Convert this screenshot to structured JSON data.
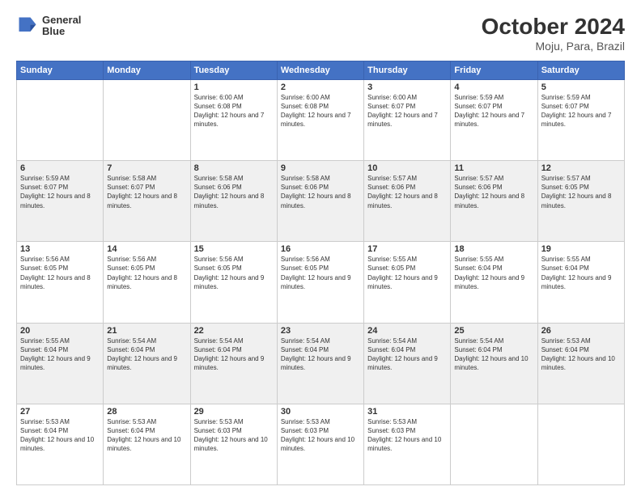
{
  "header": {
    "logo_line1": "General",
    "logo_line2": "Blue",
    "title": "October 2024",
    "subtitle": "Moju, Para, Brazil"
  },
  "days_of_week": [
    "Sunday",
    "Monday",
    "Tuesday",
    "Wednesday",
    "Thursday",
    "Friday",
    "Saturday"
  ],
  "weeks": [
    [
      {
        "day": "",
        "empty": true
      },
      {
        "day": "",
        "empty": true
      },
      {
        "day": "1",
        "sunrise": "Sunrise: 6:00 AM",
        "sunset": "Sunset: 6:08 PM",
        "daylight": "Daylight: 12 hours and 7 minutes."
      },
      {
        "day": "2",
        "sunrise": "Sunrise: 6:00 AM",
        "sunset": "Sunset: 6:08 PM",
        "daylight": "Daylight: 12 hours and 7 minutes."
      },
      {
        "day": "3",
        "sunrise": "Sunrise: 6:00 AM",
        "sunset": "Sunset: 6:07 PM",
        "daylight": "Daylight: 12 hours and 7 minutes."
      },
      {
        "day": "4",
        "sunrise": "Sunrise: 5:59 AM",
        "sunset": "Sunset: 6:07 PM",
        "daylight": "Daylight: 12 hours and 7 minutes."
      },
      {
        "day": "5",
        "sunrise": "Sunrise: 5:59 AM",
        "sunset": "Sunset: 6:07 PM",
        "daylight": "Daylight: 12 hours and 7 minutes."
      }
    ],
    [
      {
        "day": "6",
        "sunrise": "Sunrise: 5:59 AM",
        "sunset": "Sunset: 6:07 PM",
        "daylight": "Daylight: 12 hours and 8 minutes."
      },
      {
        "day": "7",
        "sunrise": "Sunrise: 5:58 AM",
        "sunset": "Sunset: 6:07 PM",
        "daylight": "Daylight: 12 hours and 8 minutes."
      },
      {
        "day": "8",
        "sunrise": "Sunrise: 5:58 AM",
        "sunset": "Sunset: 6:06 PM",
        "daylight": "Daylight: 12 hours and 8 minutes."
      },
      {
        "day": "9",
        "sunrise": "Sunrise: 5:58 AM",
        "sunset": "Sunset: 6:06 PM",
        "daylight": "Daylight: 12 hours and 8 minutes."
      },
      {
        "day": "10",
        "sunrise": "Sunrise: 5:57 AM",
        "sunset": "Sunset: 6:06 PM",
        "daylight": "Daylight: 12 hours and 8 minutes."
      },
      {
        "day": "11",
        "sunrise": "Sunrise: 5:57 AM",
        "sunset": "Sunset: 6:06 PM",
        "daylight": "Daylight: 12 hours and 8 minutes."
      },
      {
        "day": "12",
        "sunrise": "Sunrise: 5:57 AM",
        "sunset": "Sunset: 6:05 PM",
        "daylight": "Daylight: 12 hours and 8 minutes."
      }
    ],
    [
      {
        "day": "13",
        "sunrise": "Sunrise: 5:56 AM",
        "sunset": "Sunset: 6:05 PM",
        "daylight": "Daylight: 12 hours and 8 minutes."
      },
      {
        "day": "14",
        "sunrise": "Sunrise: 5:56 AM",
        "sunset": "Sunset: 6:05 PM",
        "daylight": "Daylight: 12 hours and 8 minutes."
      },
      {
        "day": "15",
        "sunrise": "Sunrise: 5:56 AM",
        "sunset": "Sunset: 6:05 PM",
        "daylight": "Daylight: 12 hours and 9 minutes."
      },
      {
        "day": "16",
        "sunrise": "Sunrise: 5:56 AM",
        "sunset": "Sunset: 6:05 PM",
        "daylight": "Daylight: 12 hours and 9 minutes."
      },
      {
        "day": "17",
        "sunrise": "Sunrise: 5:55 AM",
        "sunset": "Sunset: 6:05 PM",
        "daylight": "Daylight: 12 hours and 9 minutes."
      },
      {
        "day": "18",
        "sunrise": "Sunrise: 5:55 AM",
        "sunset": "Sunset: 6:04 PM",
        "daylight": "Daylight: 12 hours and 9 minutes."
      },
      {
        "day": "19",
        "sunrise": "Sunrise: 5:55 AM",
        "sunset": "Sunset: 6:04 PM",
        "daylight": "Daylight: 12 hours and 9 minutes."
      }
    ],
    [
      {
        "day": "20",
        "sunrise": "Sunrise: 5:55 AM",
        "sunset": "Sunset: 6:04 PM",
        "daylight": "Daylight: 12 hours and 9 minutes."
      },
      {
        "day": "21",
        "sunrise": "Sunrise: 5:54 AM",
        "sunset": "Sunset: 6:04 PM",
        "daylight": "Daylight: 12 hours and 9 minutes."
      },
      {
        "day": "22",
        "sunrise": "Sunrise: 5:54 AM",
        "sunset": "Sunset: 6:04 PM",
        "daylight": "Daylight: 12 hours and 9 minutes."
      },
      {
        "day": "23",
        "sunrise": "Sunrise: 5:54 AM",
        "sunset": "Sunset: 6:04 PM",
        "daylight": "Daylight: 12 hours and 9 minutes."
      },
      {
        "day": "24",
        "sunrise": "Sunrise: 5:54 AM",
        "sunset": "Sunset: 6:04 PM",
        "daylight": "Daylight: 12 hours and 9 minutes."
      },
      {
        "day": "25",
        "sunrise": "Sunrise: 5:54 AM",
        "sunset": "Sunset: 6:04 PM",
        "daylight": "Daylight: 12 hours and 10 minutes."
      },
      {
        "day": "26",
        "sunrise": "Sunrise: 5:53 AM",
        "sunset": "Sunset: 6:04 PM",
        "daylight": "Daylight: 12 hours and 10 minutes."
      }
    ],
    [
      {
        "day": "27",
        "sunrise": "Sunrise: 5:53 AM",
        "sunset": "Sunset: 6:04 PM",
        "daylight": "Daylight: 12 hours and 10 minutes."
      },
      {
        "day": "28",
        "sunrise": "Sunrise: 5:53 AM",
        "sunset": "Sunset: 6:04 PM",
        "daylight": "Daylight: 12 hours and 10 minutes."
      },
      {
        "day": "29",
        "sunrise": "Sunrise: 5:53 AM",
        "sunset": "Sunset: 6:03 PM",
        "daylight": "Daylight: 12 hours and 10 minutes."
      },
      {
        "day": "30",
        "sunrise": "Sunrise: 5:53 AM",
        "sunset": "Sunset: 6:03 PM",
        "daylight": "Daylight: 12 hours and 10 minutes."
      },
      {
        "day": "31",
        "sunrise": "Sunrise: 5:53 AM",
        "sunset": "Sunset: 6:03 PM",
        "daylight": "Daylight: 12 hours and 10 minutes."
      },
      {
        "day": "",
        "empty": true
      },
      {
        "day": "",
        "empty": true
      }
    ]
  ]
}
